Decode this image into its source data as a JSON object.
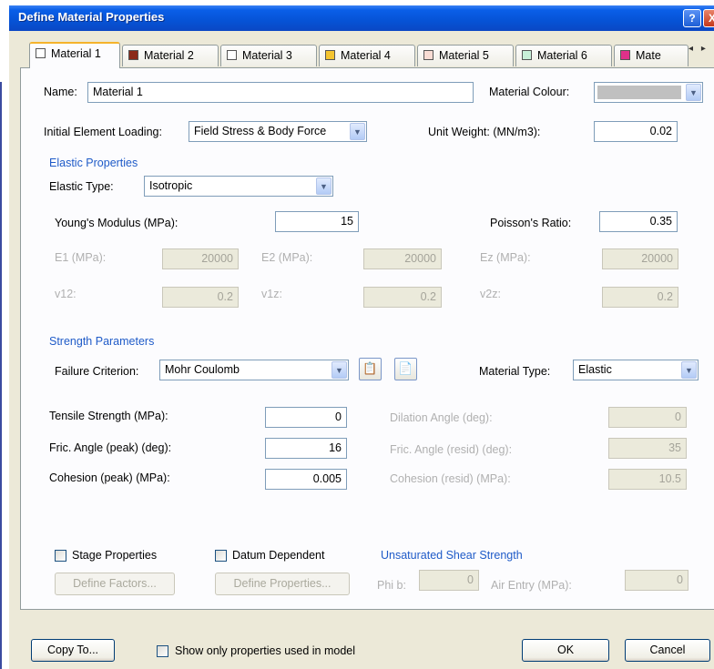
{
  "window": {
    "title": "Define Material Properties",
    "help_label": "?",
    "close_label": "X"
  },
  "tabs": [
    {
      "label": "Material 1",
      "color": "#ffffff"
    },
    {
      "label": "Material 2",
      "color": "#8b2a1a"
    },
    {
      "label": "Material 3",
      "color": "#ffffff"
    },
    {
      "label": "Material 4",
      "color": "#f4c430"
    },
    {
      "label": "Material 5",
      "color": "#f8dcd4"
    },
    {
      "label": "Material 6",
      "color": "#c8f0d8"
    },
    {
      "label": "Mate",
      "color": "#e0308a"
    }
  ],
  "tab_scroll": {
    "left": "◂",
    "right": "▸"
  },
  "general": {
    "name_label": "Name:",
    "name_value": "Material 1",
    "colour_label": "Material Colour:",
    "colour_value": "#c0c0c0",
    "loading_label": "Initial Element Loading:",
    "loading_value": "Field Stress & Body Force",
    "unit_weight_label": "Unit Weight: (MN/m3):",
    "unit_weight_value": "0.02"
  },
  "elastic": {
    "section": "Elastic Properties",
    "type_label": "Elastic Type:",
    "type_value": "Isotropic",
    "youngs_label": "Young's Modulus (MPa):",
    "youngs_value": "15",
    "poisson_label": "Poisson's Ratio:",
    "poisson_value": "0.35",
    "e1_label": "E1 (MPa):",
    "e1_value": "20000",
    "e2_label": "E2 (MPa):",
    "e2_value": "20000",
    "ez_label": "Ez (MPa):",
    "ez_value": "20000",
    "v12_label": "v12:",
    "v12_value": "0.2",
    "v1z_label": "v1z:",
    "v1z_value": "0.2",
    "v2z_label": "v2z:",
    "v2z_value": "0.2"
  },
  "strength": {
    "section": "Strength Parameters",
    "criterion_label": "Failure Criterion:",
    "criterion_value": "Mohr Coulomb",
    "material_type_label": "Material Type:",
    "material_type_value": "Elastic",
    "tensile_label": "Tensile Strength (MPa):",
    "tensile_value": "0",
    "fric_peak_label": "Fric. Angle (peak) (deg):",
    "fric_peak_value": "16",
    "coh_peak_label": "Cohesion (peak) (MPa):",
    "coh_peak_value": "0.005",
    "dilation_label": "Dilation Angle (deg):",
    "dilation_value": "0",
    "fric_resid_label": "Fric. Angle (resid) (deg):",
    "fric_resid_value": "35",
    "coh_resid_label": "Cohesion (resid) (MPa):",
    "coh_resid_value": "10.5"
  },
  "stage": {
    "stage_label": "Stage Properties",
    "stage_button": "Define Factors...",
    "datum_label": "Datum Dependent",
    "datum_button": "Define Properties...",
    "unsat_section": "Unsaturated Shear Strength",
    "phib_label": "Phi b:",
    "phib_value": "0",
    "air_label": "Air Entry (MPa):",
    "air_value": "0"
  },
  "footer": {
    "copy_to": "Copy To...",
    "show_only_label": "Show only properties used in model",
    "ok": "OK",
    "cancel": "Cancel"
  }
}
